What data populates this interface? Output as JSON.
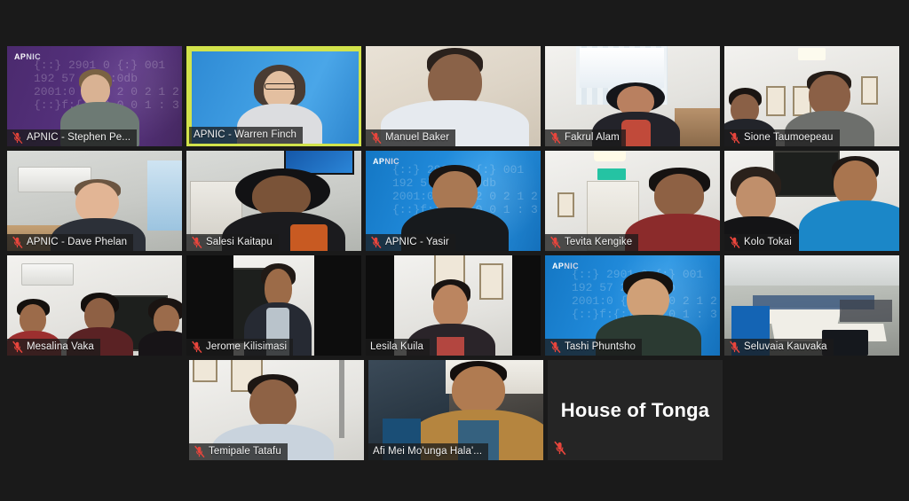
{
  "app": {
    "view": "gallery-view",
    "background_color": "#1a1a1a",
    "active_speaker_border_color": "#d2e34b",
    "mute_icon_color": "#e8453c",
    "name_label_background": "rgba(26,26,26,0.76)",
    "name_label_text_color": "#f2f2f2"
  },
  "grid": {
    "columns": 5,
    "rows": 4,
    "total_participants": 18
  },
  "icons": {
    "muted": "microphone-muted-icon"
  },
  "participants": [
    {
      "id": "p1",
      "name": "APNIC - Stephen Pe...",
      "muted": true,
      "active_speaker": false,
      "camera_on": true,
      "background_label": "APNIC",
      "row": 1,
      "col": 1
    },
    {
      "id": "p2",
      "name": "APNIC - Warren Finch",
      "muted": false,
      "active_speaker": true,
      "camera_on": true,
      "background_label": "",
      "row": 1,
      "col": 2
    },
    {
      "id": "p3",
      "name": "Manuel Baker",
      "muted": true,
      "active_speaker": false,
      "camera_on": true,
      "background_label": "",
      "row": 1,
      "col": 3
    },
    {
      "id": "p4",
      "name": "Fakrul Alam",
      "muted": true,
      "active_speaker": false,
      "camera_on": true,
      "background_label": "",
      "row": 1,
      "col": 4
    },
    {
      "id": "p5",
      "name": "Sione Taumoepeau",
      "muted": true,
      "active_speaker": false,
      "camera_on": true,
      "background_label": "",
      "row": 1,
      "col": 5
    },
    {
      "id": "p6",
      "name": "APNIC - Dave Phelan",
      "muted": true,
      "active_speaker": false,
      "camera_on": true,
      "background_label": "",
      "row": 2,
      "col": 1
    },
    {
      "id": "p7",
      "name": "Salesi Kaitapu",
      "muted": true,
      "active_speaker": false,
      "camera_on": true,
      "background_label": "",
      "row": 2,
      "col": 2
    },
    {
      "id": "p8",
      "name": "APNIC - Yasir",
      "muted": true,
      "active_speaker": false,
      "camera_on": true,
      "background_label": "APNIC",
      "row": 2,
      "col": 3
    },
    {
      "id": "p9",
      "name": "Tevita Kengike",
      "muted": true,
      "active_speaker": false,
      "camera_on": true,
      "background_label": "",
      "row": 2,
      "col": 4
    },
    {
      "id": "p10",
      "name": "Kolo Tokai",
      "muted": true,
      "active_speaker": false,
      "camera_on": true,
      "background_label": "",
      "row": 2,
      "col": 5
    },
    {
      "id": "p11",
      "name": "Mesalina Vaka",
      "muted": true,
      "active_speaker": false,
      "camera_on": true,
      "background_label": "",
      "row": 3,
      "col": 1
    },
    {
      "id": "p12",
      "name": "Jerome Kilisimasi",
      "muted": true,
      "active_speaker": false,
      "camera_on": true,
      "background_label": "",
      "row": 3,
      "col": 2
    },
    {
      "id": "p13",
      "name": "Lesila Kuila",
      "muted": false,
      "active_speaker": false,
      "camera_on": true,
      "background_label": "",
      "row": 3,
      "col": 3
    },
    {
      "id": "p14",
      "name": "Tashi Phuntsho",
      "muted": true,
      "active_speaker": false,
      "camera_on": true,
      "background_label": "APNIC",
      "row": 3,
      "col": 4
    },
    {
      "id": "p15",
      "name": "Seluvaia Kauvaka",
      "muted": true,
      "active_speaker": false,
      "camera_on": true,
      "background_label": "",
      "row": 3,
      "col": 5
    },
    {
      "id": "p16",
      "name": "Temipale Tatafu",
      "muted": true,
      "active_speaker": false,
      "camera_on": true,
      "background_label": "",
      "row": 4,
      "col": 2
    },
    {
      "id": "p17",
      "name": "Afi Mei Mo'unga Hala'...",
      "muted": false,
      "active_speaker": false,
      "camera_on": true,
      "background_label": "",
      "row": 4,
      "col": 3
    },
    {
      "id": "p18",
      "name": "House of Tonga",
      "muted": true,
      "active_speaker": false,
      "camera_on": false,
      "background_label": "",
      "row": 4,
      "col": 4
    }
  ],
  "decor": {
    "code_text_1": "{::} 2901 0 {:} 001",
    "code_text_2": "192 57  2001:0db",
    "code_text_3": "2001:0 {::}  2 0 2 1 2",
    "code_text_4": "{::}f:{:}      9 0 0 1 : 3"
  }
}
